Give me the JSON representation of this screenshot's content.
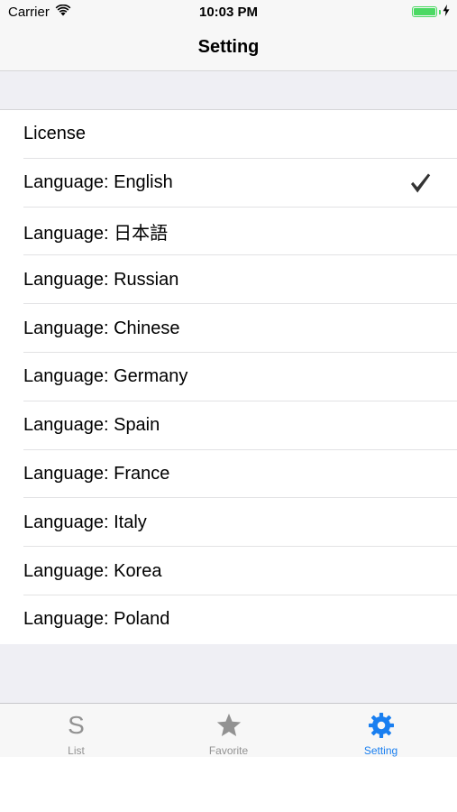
{
  "status_bar": {
    "carrier": "Carrier",
    "time": "10:03 PM",
    "icons": [
      "wifi-icon",
      "battery-icon",
      "charging-bolt-icon"
    ]
  },
  "nav": {
    "title": "Setting"
  },
  "settings": {
    "rows": [
      {
        "label": "License",
        "checked": false
      },
      {
        "label": "Language: English",
        "checked": true
      },
      {
        "label": "Language: 日本語",
        "checked": false
      },
      {
        "label": "Language: Russian",
        "checked": false
      },
      {
        "label": "Language: Chinese",
        "checked": false
      },
      {
        "label": "Language: Germany",
        "checked": false
      },
      {
        "label": "Language: Spain",
        "checked": false
      },
      {
        "label": "Language: France",
        "checked": false
      },
      {
        "label": "Language: Italy",
        "checked": false
      },
      {
        "label": "Language: Korea",
        "checked": false
      },
      {
        "label": "Language: Poland",
        "checked": false
      }
    ]
  },
  "tab_bar": {
    "tabs": [
      {
        "label": "List",
        "icon_text": "S",
        "icon": "s-letter-icon",
        "active": false
      },
      {
        "label": "Favorite",
        "icon": "star-icon",
        "active": false
      },
      {
        "label": "Setting",
        "icon": "gear-icon",
        "active": true
      }
    ]
  },
  "colors": {
    "accent": "#1a7ff0",
    "inactive": "#929292",
    "battery": "#4cd964",
    "group_background": "#efeff4"
  }
}
